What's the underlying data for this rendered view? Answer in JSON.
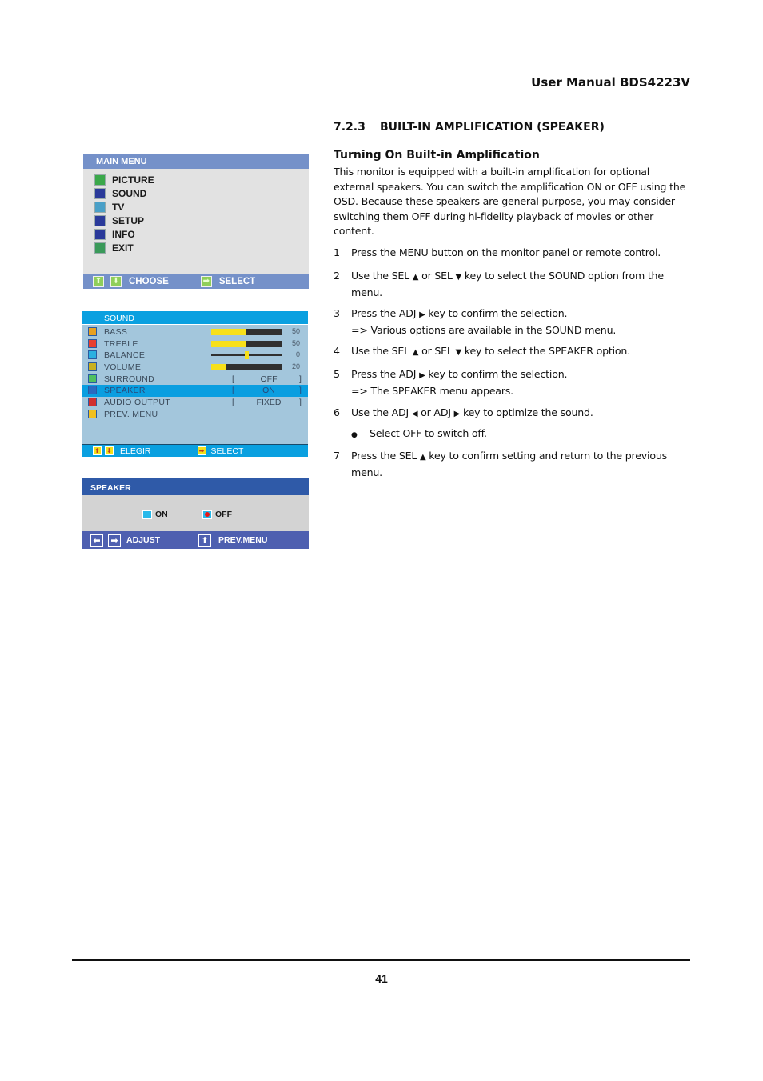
{
  "header": {
    "title": "User Manual BDS4223V"
  },
  "footer": {
    "page_number": "41"
  },
  "section": {
    "number": "7.2.3",
    "title": "BUILT-IN AMPLIFICATION (SPEAKER)",
    "subheading": "Turning On Built-in Amplification",
    "intro": "This monitor is equipped with a built-in amplification for optional external speakers. You can switch the amplification ON or OFF using the OSD. Because these speakers are general purpose, you may consider switching them OFF during hi-fidelity playback of movies or other content."
  },
  "steps": [
    {
      "num": "1",
      "parts": [
        "Press the MENU button on the monitor panel or remote control."
      ]
    },
    {
      "num": "2",
      "parts": [
        "Use the SEL ",
        "▲",
        " or SEL ",
        "▼",
        " key to select the SOUND option from the menu."
      ]
    },
    {
      "num": "3",
      "parts": [
        "Press the ADJ ",
        "▶",
        " key to confirm the selection."
      ],
      "result": "=> Various options are available in the SOUND menu."
    },
    {
      "num": "4",
      "parts": [
        "Use the SEL ",
        "▲",
        " or SEL ",
        "▼",
        " key to select the SPEAKER option."
      ]
    },
    {
      "num": "5",
      "parts": [
        "Press the ADJ ",
        "▶",
        " key to confirm the selection."
      ],
      "result": "=> The SPEAKER menu appears."
    },
    {
      "num": "6",
      "parts": [
        "Use the ADJ ",
        "◀",
        " or ADJ ",
        "▶",
        "  key to optimize the sound."
      ]
    },
    {
      "num": "7",
      "parts": [
        "Press the SEL ",
        "▲",
        " key to confirm setting and return to the previous menu."
      ]
    }
  ],
  "bullet": {
    "symbol": "●",
    "text": "Select OFF to switch off."
  },
  "main_menu": {
    "title": "MAIN  MENU",
    "items": [
      {
        "label": "PICTURE",
        "icon": "picture-icon",
        "color": "#3aa84a"
      },
      {
        "label": "SOUND",
        "icon": "music-note-icon",
        "color": "#2a3a9a"
      },
      {
        "label": "TV",
        "icon": "tv-icon",
        "color": "#4aa0c8"
      },
      {
        "label": "SETUP",
        "icon": "wrench-icon",
        "color": "#2a3a9a"
      },
      {
        "label": "INFO",
        "icon": "info-exclamation-icon",
        "color": "#2a3a9a"
      },
      {
        "label": "EXIT",
        "icon": "exit-door-icon",
        "color": "#3a9a5a"
      }
    ],
    "footer": {
      "up_icon": "⬆",
      "down_icon": "⬇",
      "choose": "CHOOSE",
      "select_icon": "➡",
      "select": "SELECT"
    },
    "colors": {
      "bar": "#7591c9",
      "body": "#e2e2e2"
    }
  },
  "sound_menu": {
    "title": "SOUND",
    "rows": [
      {
        "label": "BASS",
        "type": "bar",
        "value": 50,
        "display": "50",
        "icon": "bass-icon"
      },
      {
        "label": "TREBLE",
        "type": "bar",
        "value": 50,
        "display": "50",
        "icon": "treble-icon"
      },
      {
        "label": "BALANCE",
        "type": "balance",
        "value": 0,
        "display": "0",
        "range": [
          -50,
          50
        ],
        "icon": "balance-icon"
      },
      {
        "label": "VOLUME",
        "type": "bar",
        "value": 20,
        "display": "20",
        "icon": "volume-icon"
      },
      {
        "label": "SURROUND",
        "type": "option",
        "display": "OFF",
        "icon": "surround-icon"
      },
      {
        "label": "SPEAKER",
        "type": "option",
        "display": "ON",
        "icon": "speaker-icon",
        "selected": true
      },
      {
        "label": "AUDIO OUTPUT",
        "type": "option",
        "display": "FIXED",
        "icon": "audio-output-icon"
      },
      {
        "label": "PREV. MENU",
        "type": "none",
        "icon": "return-icon"
      }
    ],
    "bar_max": 100,
    "bracket_left": "[",
    "bracket_right": "]",
    "footer": {
      "up_icon": "⬆",
      "down_icon": "⬇",
      "choose": "ELEGIR",
      "select_icon": "➡",
      "select": "SELECT"
    },
    "colors": {
      "bar": "#0aa0e0",
      "body": "#a3c6dc",
      "fill": "#f7e01a"
    }
  },
  "speaker_menu": {
    "title": "SPEAKER",
    "options": [
      {
        "label": "ON",
        "selected": false
      },
      {
        "label": "OFF",
        "selected": true
      }
    ],
    "footer": {
      "left_icon": "⬅",
      "right_icon": "➡",
      "adjust": "ADJUST",
      "up_icon": "⬆",
      "prev": "PREV.MENU"
    },
    "colors": {
      "title": "#2f5aa8",
      "footer": "#4e5fb0",
      "body": "#d3d3d3"
    }
  }
}
